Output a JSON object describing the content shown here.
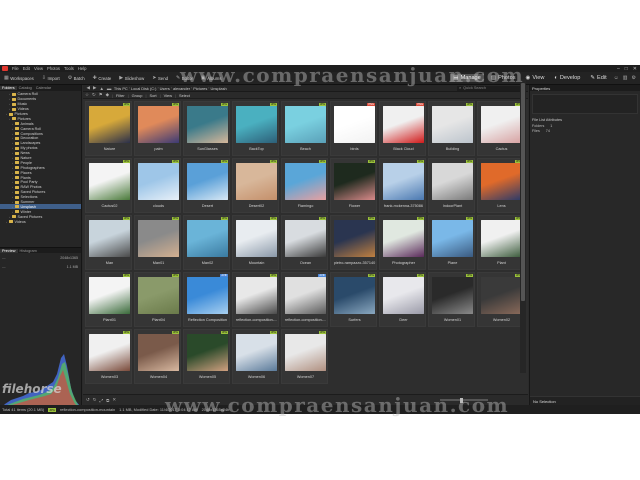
{
  "menubar": {
    "items": [
      "File",
      "Edit",
      "View",
      "Photos",
      "Tools",
      "Help"
    ]
  },
  "toolbar": {
    "buttons": [
      {
        "label": "Workspaces",
        "icon": "grid-icon"
      },
      {
        "label": "Import",
        "icon": "import-icon"
      },
      {
        "label": "Batch",
        "icon": "batch-icon"
      },
      {
        "label": "Create",
        "icon": "create-icon"
      },
      {
        "label": "Slideshow",
        "icon": "slideshow-icon"
      },
      {
        "label": "Send",
        "icon": "send-icon"
      },
      {
        "label": "Editor",
        "icon": "editor-icon"
      },
      {
        "label": "Albums",
        "icon": "albums-icon"
      }
    ],
    "modes": [
      "Manage",
      "Photos",
      "View",
      "Develop",
      "Edit"
    ],
    "active_mode": "Manage"
  },
  "left_panel": {
    "tabs": [
      "Folders",
      "Catalog",
      "Calendar"
    ],
    "tree": [
      {
        "label": "Camera Roll",
        "indent": 3
      },
      {
        "label": "Documents",
        "indent": 3
      },
      {
        "label": "Music",
        "indent": 3
      },
      {
        "label": "Videos",
        "indent": 3
      },
      {
        "label": "Pictures",
        "indent": 2
      },
      {
        "label": "Pictures",
        "indent": 3
      },
      {
        "label": "Animals",
        "indent": 4
      },
      {
        "label": "Camera Roll",
        "indent": 4
      },
      {
        "label": "Compositions",
        "indent": 4
      },
      {
        "label": "Decoration",
        "indent": 4
      },
      {
        "label": "Landscapes",
        "indent": 4
      },
      {
        "label": "My photos",
        "indent": 4
      },
      {
        "label": "News",
        "indent": 4
      },
      {
        "label": "Nature",
        "indent": 4
      },
      {
        "label": "People",
        "indent": 4
      },
      {
        "label": "Photographers",
        "indent": 4
      },
      {
        "label": "Places",
        "indent": 4
      },
      {
        "label": "Plants",
        "indent": 4
      },
      {
        "label": "Pool Party",
        "indent": 4
      },
      {
        "label": "RAW Photos",
        "indent": 4
      },
      {
        "label": "Saved Pictures",
        "indent": 4
      },
      {
        "label": "Selections",
        "indent": 4
      },
      {
        "label": "Summer",
        "indent": 4
      },
      {
        "label": "Unsplash",
        "indent": 4,
        "selected": true
      },
      {
        "label": "Winter",
        "indent": 4
      },
      {
        "label": "Saved Pictures",
        "indent": 3
      },
      {
        "label": "Videos",
        "indent": 2
      }
    ],
    "preview_tabs": [
      "Preview",
      "Histogram"
    ],
    "dims": "2048x1365",
    "size": "1.1 MB"
  },
  "address": {
    "crumbs": [
      "This PC",
      "Local Disk (C:)",
      "Users",
      "alexander",
      "Pictures",
      "Unsplash"
    ],
    "quick_search_placeholder": "Quick Search"
  },
  "filter_bar": [
    "Filter",
    "Group",
    "Sort",
    "View",
    "Select"
  ],
  "thumbnails": [
    {
      "label": "Nature",
      "badge": "JPG",
      "colors": [
        "#d7a93a",
        "#2a2f4a"
      ]
    },
    {
      "label": "palm",
      "badge": "JPG",
      "colors": [
        "#e08a5a",
        "#3b3a75"
      ]
    },
    {
      "label": "SunGlasses",
      "badge": "JPG",
      "colors": [
        "#3a7a8a",
        "#d6b79a"
      ]
    },
    {
      "label": "BackTop",
      "badge": "JPG",
      "colors": [
        "#4ab0c0",
        "#2d5f78"
      ]
    },
    {
      "label": "Beach",
      "badge": "JPG",
      "colors": [
        "#7ad0e0",
        "#5aa0b8"
      ]
    },
    {
      "label": "birds",
      "badge": "PNG",
      "colors": [
        "#ffffff",
        "#f2f2f2"
      ]
    },
    {
      "label": "Black Cloud",
      "badge": "PNG",
      "colors": [
        "#f0f0f0",
        "#d11a1a"
      ]
    },
    {
      "label": "Building",
      "badge": "JPG",
      "colors": [
        "#e6e6e6",
        "#bcc4cc"
      ]
    },
    {
      "label": "Cactus",
      "badge": "JPG",
      "colors": [
        "#f0f0f0",
        "#d7a1a1"
      ]
    },
    {
      "label": "Cactus02",
      "badge": "JPG",
      "colors": [
        "#f4f4f4",
        "#4a7a3a"
      ]
    },
    {
      "label": "clouds",
      "badge": "JPG",
      "colors": [
        "#9ec6e8",
        "#e8f0f8"
      ]
    },
    {
      "label": "Desert",
      "badge": "JPG",
      "colors": [
        "#5aa0d8",
        "#d8e8f4"
      ]
    },
    {
      "label": "Desert02",
      "badge": "JPG",
      "colors": [
        "#d8b79a",
        "#c48f6a"
      ]
    },
    {
      "label": "Flamingo",
      "badge": "JPG",
      "colors": [
        "#5aa6d8",
        "#e8a0a0"
      ]
    },
    {
      "label": "Flower",
      "badge": "JPG",
      "colors": [
        "#1e2a1e",
        "#d98a8a"
      ]
    },
    {
      "label": "frank-mckenna-375086",
      "badge": "JPG",
      "colors": [
        "#b8d0e8",
        "#4a78b0"
      ]
    },
    {
      "label": "IndoorPlant",
      "badge": "JPG",
      "colors": [
        "#d8d8d8",
        "#7a7a7a"
      ]
    },
    {
      "label": "Lens",
      "badge": "JPG",
      "colors": [
        "#e06a2a",
        "#2a3a6a"
      ]
    },
    {
      "label": "Man",
      "badge": "JPG",
      "colors": [
        "#c8d4dc",
        "#4a4a4a"
      ]
    },
    {
      "label": "Man01",
      "badge": "JPG",
      "colors": [
        "#8a8a8a",
        "#d4b090"
      ]
    },
    {
      "label": "Man02",
      "badge": "JPG",
      "colors": [
        "#6ab4d8",
        "#3a7aa0"
      ]
    },
    {
      "label": "Mountain",
      "badge": "JPG",
      "colors": [
        "#e8ecf0",
        "#8a98a8"
      ]
    },
    {
      "label": "Ocean",
      "badge": "JPG",
      "colors": [
        "#d8dce0",
        "#3a3a3a"
      ]
    },
    {
      "label": "pietro-rampazzo-357140",
      "badge": "JPG",
      "colors": [
        "#2a3550",
        "#c08040"
      ]
    },
    {
      "label": "Photographer",
      "badge": "JPG",
      "colors": [
        "#e0e8e0",
        "#5a2a5a"
      ]
    },
    {
      "label": "Plane",
      "badge": "JPG",
      "colors": [
        "#7ab8e8",
        "#3a5a80"
      ]
    },
    {
      "label": "Plant",
      "badge": "JPG",
      "colors": [
        "#f0f0f0",
        "#3a5a3a"
      ]
    },
    {
      "label": "Plant01",
      "badge": "JPG",
      "colors": [
        "#f4f4f4",
        "#3a6a3a"
      ]
    },
    {
      "label": "Plant04",
      "badge": "JPG",
      "colors": [
        "#8a9a6a",
        "#6a7a4a"
      ]
    },
    {
      "label": "Reflection Composition",
      "badge": "AVIF",
      "colors": [
        "#3a8ad8",
        "#a8d0f0"
      ]
    },
    {
      "label": "reflection-composition-...",
      "badge": "JPG",
      "colors": [
        "#e8e8e8",
        "#4a4a4a"
      ]
    },
    {
      "label": "reflection-composition-...",
      "badge": "AVIF",
      "colors": [
        "#e0e0e0",
        "#5a5a5a"
      ]
    },
    {
      "label": "Surfers",
      "badge": "JPG",
      "colors": [
        "#2a4a6a",
        "#8aa8c0"
      ]
    },
    {
      "label": "Deer",
      "badge": "JPG",
      "colors": [
        "#e8e8ec",
        "#9a9aa8"
      ]
    },
    {
      "label": "Women01",
      "badge": "JPG",
      "colors": [
        "#2a2a2a",
        "#8a8a8a"
      ]
    },
    {
      "label": "Women02",
      "badge": "JPG",
      "colors": [
        "#3a3a3a",
        "#8a6a5a"
      ]
    },
    {
      "label": "Women03",
      "badge": "JPG",
      "colors": [
        "#f0f0f0",
        "#7a4a3a"
      ]
    },
    {
      "label": "Women04",
      "badge": "JPG",
      "colors": [
        "#7a5a4a",
        "#d8b8a0"
      ]
    },
    {
      "label": "Women05",
      "badge": "JPG",
      "colors": [
        "#2a4a2a",
        "#d0a080"
      ]
    },
    {
      "label": "Women06",
      "badge": "JPG",
      "colors": [
        "#d8e0e8",
        "#5a7a9a"
      ]
    },
    {
      "label": "Women07",
      "badge": "JPG",
      "colors": [
        "#e8e8e8",
        "#b09080"
      ]
    }
  ],
  "right_panel": {
    "title": "Properties",
    "section": "File List Attributes",
    "rows": [
      {
        "key": "Folders",
        "value": "1"
      },
      {
        "key": "Files",
        "value": "74"
      }
    ],
    "footer": "No Selection"
  },
  "status": {
    "left": "Total 41 items (20.1 MB)",
    "type": "JPG",
    "file": "reflection-composition-mountain",
    "size": "1.1 MB, Modified Date: 11/4/2017 3:04:17 AM",
    "dims": "2048x1365x24b"
  },
  "watermark": {
    "text": "www.compraensanjuan.com",
    "logo": "filehorse"
  },
  "colors": {
    "accent": "#3f5f8a",
    "jpg_badge": "#9bc23a",
    "png_badge": "#d94a3a",
    "avif_badge": "#4a86d9",
    "folder": "#d9b44a"
  }
}
